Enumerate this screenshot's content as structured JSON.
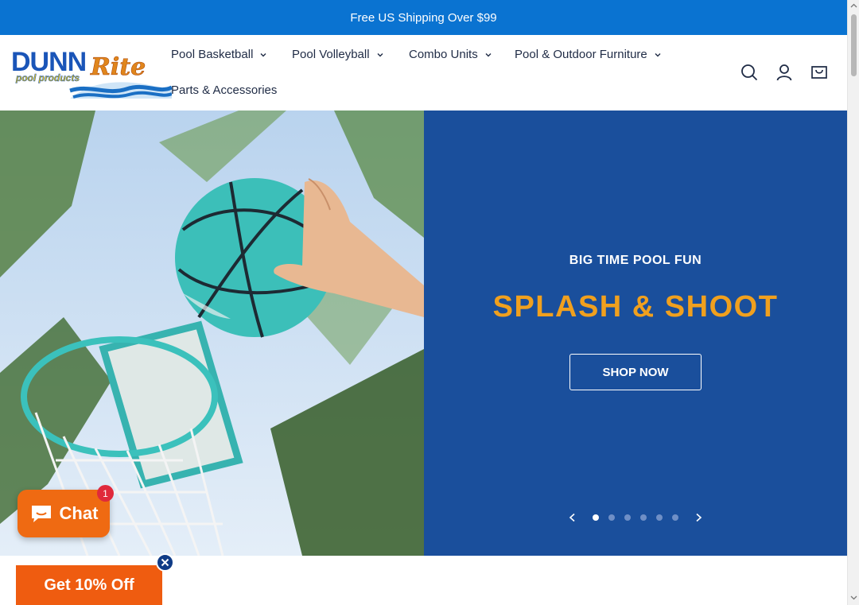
{
  "announcement": {
    "text": "Free US Shipping Over $99"
  },
  "brand": {
    "logo_line1": "DUNN",
    "logo_script": "Rite",
    "logo_tagline": "pool products"
  },
  "nav": {
    "items": [
      {
        "label": "Pool Basketball",
        "has_dropdown": true
      },
      {
        "label": "Pool Volleyball",
        "has_dropdown": true
      },
      {
        "label": "Combo Units",
        "has_dropdown": true
      },
      {
        "label": "Pool & Outdoor Furniture",
        "has_dropdown": true
      },
      {
        "label": "Parts & Accessories",
        "has_dropdown": false
      }
    ]
  },
  "header_icons": [
    "search-icon",
    "account-icon",
    "cart-icon"
  ],
  "hero": {
    "eyebrow": "BIG TIME POOL FUN",
    "headline": "SPLASH & SHOOT",
    "cta": "SHOP NOW",
    "slides_total": 6,
    "active_slide": 1
  },
  "chat": {
    "label": "Chat",
    "badge": "1"
  },
  "promo": {
    "label": "Get 10% Off"
  },
  "colors": {
    "announcement_bg": "#0a73d1",
    "hero_panel_bg": "#1a4f9c",
    "headline": "#f0a01e",
    "chat_bg": "#ef6a12",
    "promo_bg": "#ef5c10"
  }
}
